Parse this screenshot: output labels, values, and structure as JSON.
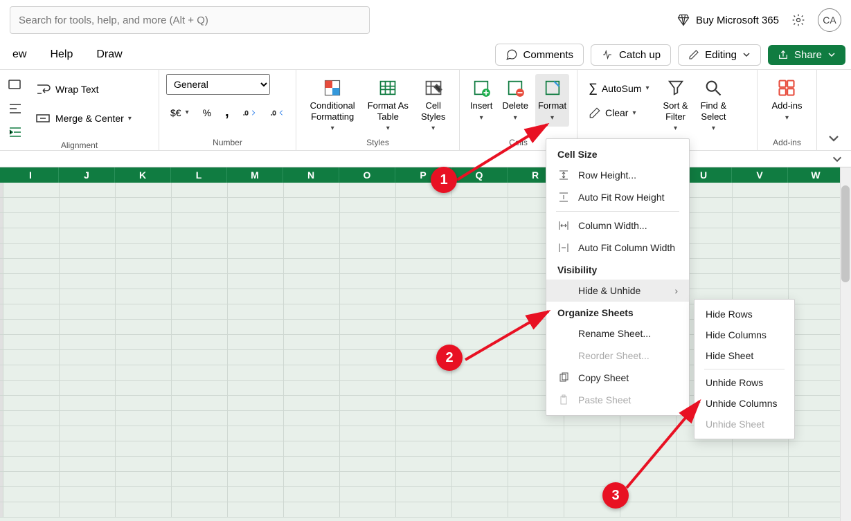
{
  "search": {
    "placeholder": "Search for tools, help, and more (Alt + Q)"
  },
  "topbar": {
    "buy_label": "Buy Microsoft 365",
    "avatar_initials": "CA"
  },
  "secbar": {
    "tabs": [
      "ew",
      "Help",
      "Draw"
    ],
    "comments": "Comments",
    "catchup": "Catch up",
    "editing": "Editing",
    "share": "Share"
  },
  "ribbon": {
    "alignment": {
      "wrap": "Wrap Text",
      "merge": "Merge & Center",
      "label": "Alignment"
    },
    "number": {
      "format_value": "General",
      "label": "Number"
    },
    "styles": {
      "cond": "Conditional\nFormatting",
      "fat": "Format As\nTable",
      "cstyles": "Cell\nStyles",
      "label": "Styles"
    },
    "cells": {
      "insert": "Insert",
      "delete": "Delete",
      "format": "Format",
      "label": "Cells"
    },
    "editing": {
      "autosum": "AutoSum",
      "clear": "Clear",
      "sort": "Sort &\nFilter",
      "find": "Find &\nSelect"
    },
    "addins": {
      "addins": "Add-ins",
      "label": "Add-ins"
    }
  },
  "columns": [
    "I",
    "J",
    "K",
    "L",
    "M",
    "N",
    "O",
    "P",
    "Q",
    "R",
    "",
    "",
    "U",
    "V",
    "W"
  ],
  "format_menu": {
    "sec_size": "Cell Size",
    "row_height": "Row Height...",
    "autofit_row": "Auto Fit Row Height",
    "col_width": "Column Width...",
    "autofit_col": "Auto Fit Column Width",
    "sec_visibility": "Visibility",
    "hide_unhide": "Hide & Unhide",
    "sec_organize": "Organize Sheets",
    "rename": "Rename Sheet...",
    "reorder": "Reorder Sheet...",
    "copy": "Copy Sheet",
    "paste": "Paste Sheet"
  },
  "submenu": {
    "hide_rows": "Hide Rows",
    "hide_cols": "Hide Columns",
    "hide_sheet": "Hide Sheet",
    "unhide_rows": "Unhide Rows",
    "unhide_cols": "Unhide Columns",
    "unhide_sheet": "Unhide Sheet"
  },
  "annotations": {
    "b1": "1",
    "b2": "2",
    "b3": "3"
  }
}
